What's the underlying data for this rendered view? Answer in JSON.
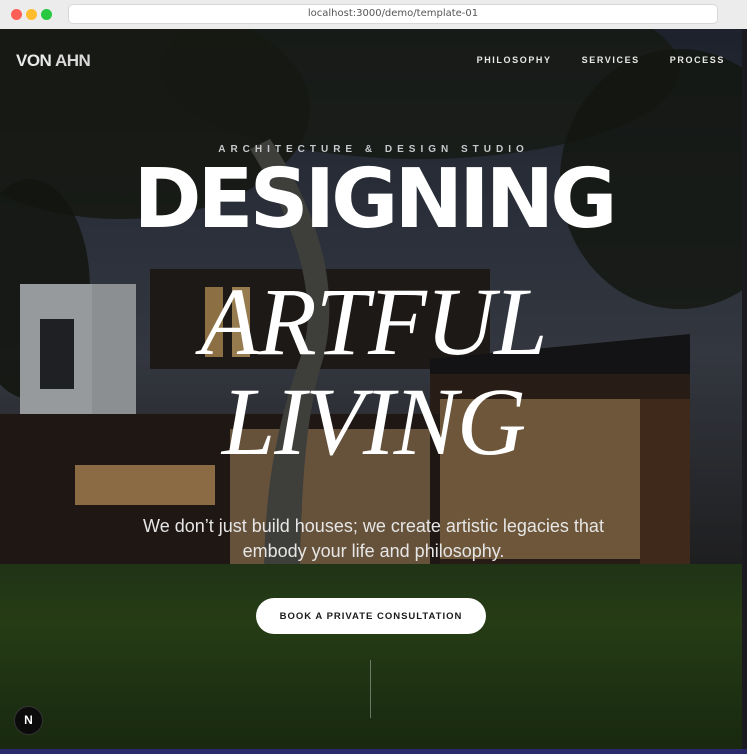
{
  "browser": {
    "url": "localhost:3000/demo/template-01"
  },
  "site": {
    "logo_part1": "VON",
    "logo_part2": "AHN",
    "nav": [
      {
        "label": "PHILOSOPHY"
      },
      {
        "label": "SERVICES"
      },
      {
        "label": "PROCESS"
      }
    ]
  },
  "hero": {
    "eyebrow": "ARCHITECTURE & DESIGN STUDIO",
    "line1": "DESIGNING",
    "line2": "ARTFUL",
    "line3": "LIVING",
    "tagline": "We don’t just build houses; we create artistic legacies that embody your life and philosophy.",
    "cta_label": "BOOK A PRIVATE CONSULTATION"
  },
  "dev_badge": {
    "label": "N"
  },
  "colors": {
    "text": "#ffffff",
    "cta_bg": "#ffffff",
    "cta_text": "#1a1a1a",
    "bottom_accent": "#2b2b6b"
  }
}
